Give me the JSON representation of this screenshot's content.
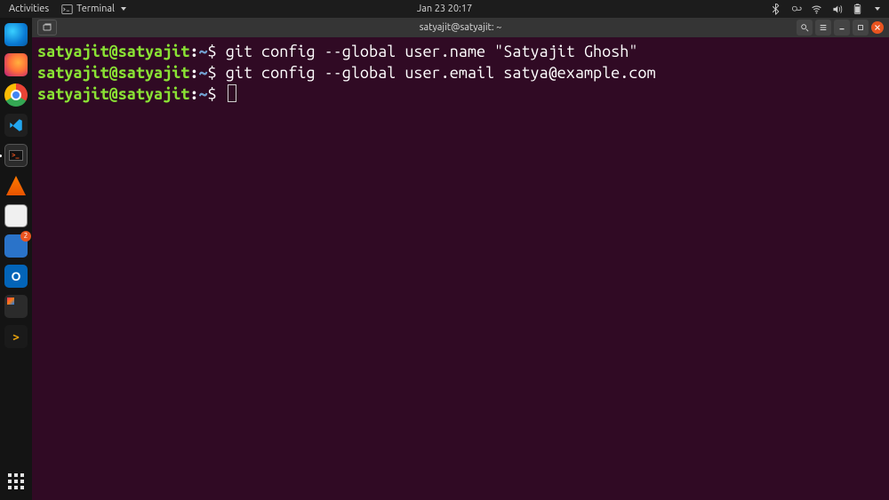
{
  "top_panel": {
    "activities": "Activities",
    "app_menu": "Terminal",
    "datetime": "Jan 23  20:17"
  },
  "tray": {
    "bluetooth": "bluetooth-icon",
    "weather": "weather-icon",
    "wifi": "wifi-icon",
    "volume": "volume-icon",
    "battery": "battery-icon"
  },
  "dock": {
    "items": [
      {
        "name": "edge",
        "label": "Microsoft Edge"
      },
      {
        "name": "firefox",
        "label": "Firefox"
      },
      {
        "name": "chrome",
        "label": "Google Chrome"
      },
      {
        "name": "vscode",
        "label": "Visual Studio Code"
      },
      {
        "name": "terminal",
        "label": "Terminal",
        "active": true
      },
      {
        "name": "vlc",
        "label": "VLC"
      },
      {
        "name": "files",
        "label": "Files"
      },
      {
        "name": "libreoffice-writer",
        "label": "LibreOffice Writer",
        "badge": "2"
      },
      {
        "name": "outlook",
        "label": "Outlook"
      },
      {
        "name": "intellij",
        "label": "IntelliJ IDEA"
      },
      {
        "name": "plex",
        "label": "Plex"
      }
    ],
    "apps_button": "Show Applications"
  },
  "window": {
    "title": "satyajit@satyajit: ~",
    "controls": {
      "new_tab": "new-tab",
      "search": "search",
      "menu": "menu",
      "minimize": "minimize",
      "maximize": "maximize",
      "close": "close"
    }
  },
  "terminal": {
    "prompt": {
      "user_host": "satyajit@satyajit",
      "sep": ":",
      "path": "~",
      "symbol": "$"
    },
    "lines": [
      {
        "command": "git config --global user.name \"Satyajit Ghosh\""
      },
      {
        "command": "git config --global user.email satya@example.com"
      },
      {
        "command": "",
        "cursor": true
      }
    ]
  }
}
